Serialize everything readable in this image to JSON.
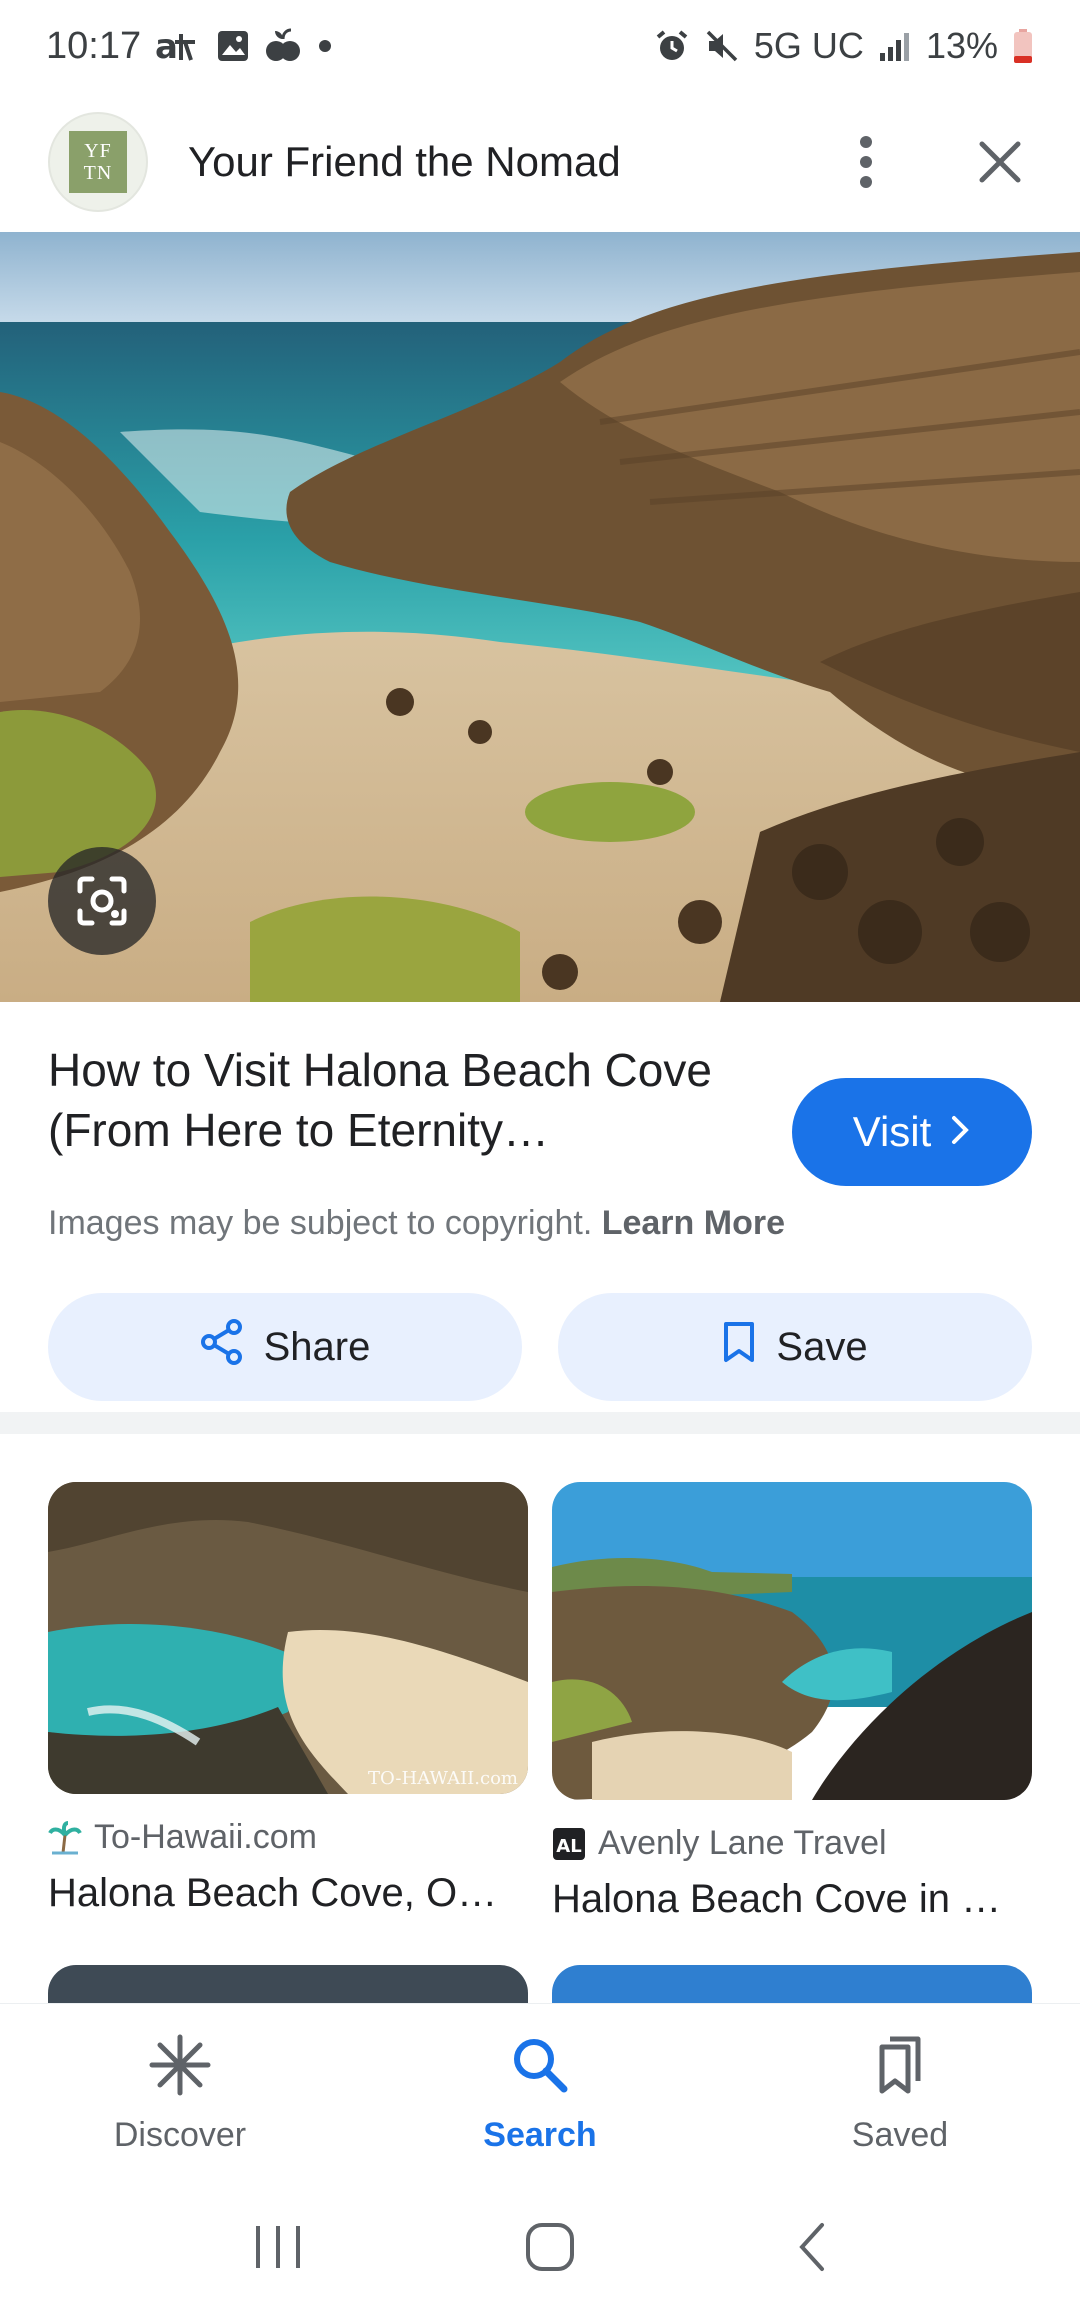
{
  "status_bar": {
    "time": "10:17",
    "network": "5G UC",
    "battery": "13%",
    "left_icons": [
      "accessibility-icon",
      "gallery-icon",
      "fruit-app-icon",
      "dot-icon"
    ],
    "right_icons": [
      "alarm-icon",
      "mute-icon",
      "signal-icon",
      "battery-icon"
    ]
  },
  "header": {
    "logo_text": "YF TN",
    "site_name": "Your Friend the Nomad",
    "menu_icon": "more-vert-icon",
    "close_icon": "close-icon"
  },
  "hero": {
    "lens_icon": "google-lens-icon"
  },
  "result": {
    "title": "How to Visit Halona Beach Cove (From Here to Eternity…",
    "visit_label": "Visit",
    "copyright_text": "Images may be subject to copyright.",
    "learn_more": "Learn More",
    "share_label": "Share",
    "save_label": "Save"
  },
  "related": [
    {
      "source": "To-Hawaii.com",
      "title": "Halona Beach Cove, O…",
      "watermark": "TO-HAWAII.com"
    },
    {
      "source": "Avenly Lane Travel",
      "title": "Halona Beach Cove in …",
      "favicon_text": "AL"
    }
  ],
  "bottom_nav": {
    "items": [
      {
        "label": "Discover",
        "icon": "asterisk-icon",
        "active": false
      },
      {
        "label": "Search",
        "icon": "search-icon",
        "active": true
      },
      {
        "label": "Saved",
        "icon": "collections-icon",
        "active": false
      }
    ]
  },
  "colors": {
    "accent": "#1a73e8",
    "pill_bg": "#e8f0fe",
    "text_secondary": "#70757a"
  }
}
